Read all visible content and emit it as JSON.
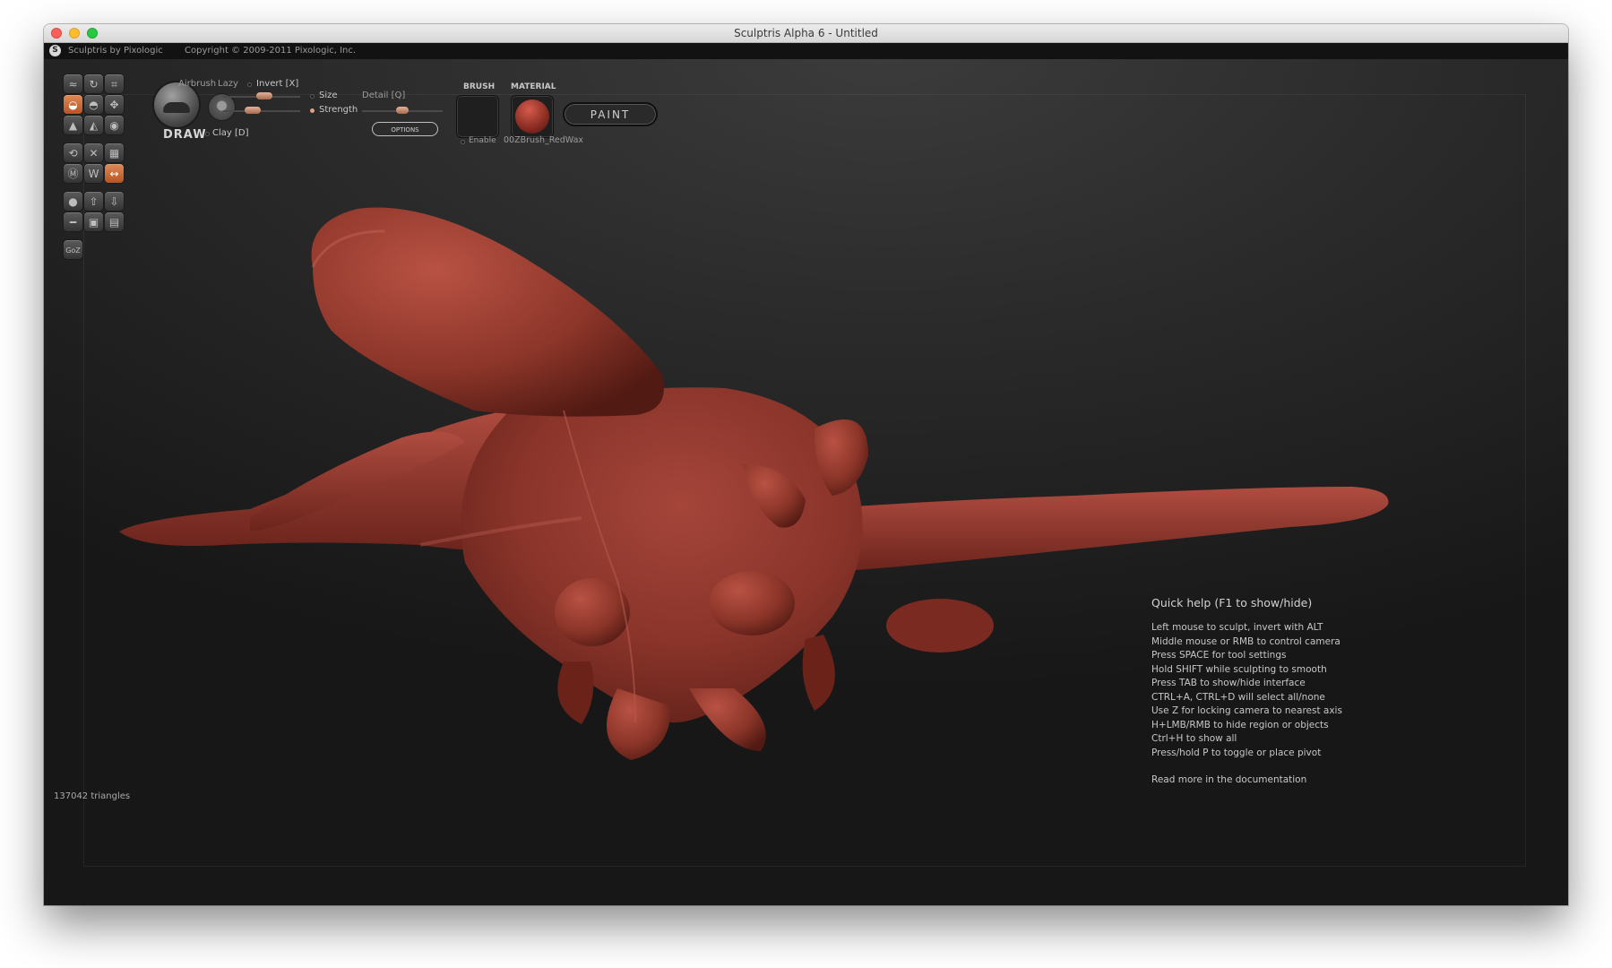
{
  "window": {
    "title": "Sculptris Alpha 6 - Untitled"
  },
  "info_bar": {
    "logo_glyph": "S",
    "app_name": "Sculptris by Pixologic",
    "copyright": "Copyright © 2009-2011 Pixologic, Inc."
  },
  "toolbar": {
    "tool_icons": [
      "brush-stroke-icon",
      "rotate-icon",
      "crop-icon",
      "draw-clay-icon",
      "inflate-icon",
      "move-icon",
      "flatten-icon",
      "pinch-icon",
      "smooth-icon",
      "reduce-icon",
      "mirror-x-icon",
      "grid-icon",
      "wireframe-icon",
      "crease-icon",
      "symmetry-icon",
      "sphere-icon",
      "mesh-import-icon",
      "mesh-export-icon",
      "plane-icon",
      "save-icon",
      "open-icon",
      "goz-icon"
    ],
    "goz_label": "GoZ",
    "active_tool": "draw",
    "brush_name": "DRAW",
    "airbrush_label": "Airbrush",
    "lazy_label": "Lazy",
    "invert_label": "Invert [X]",
    "size_label": "Size",
    "detail_label": "Detail [Q]",
    "strength_label": "Strength",
    "clay_label": "Clay [D]",
    "size_level": 0.55,
    "strength_level": 0.35,
    "detail_level": 0.5,
    "options_label": "OPTIONS",
    "brush_header": "BRUSH",
    "enable_label": "Enable",
    "material_header": "MATERIAL",
    "material_name": "00ZBrush_RedWax",
    "paint_label": "PAINT"
  },
  "quick_help": {
    "title": "Quick help (F1 to show/hide)",
    "lines": [
      "Left mouse to sculpt, invert with ALT",
      "Middle mouse or RMB to control camera",
      "Press SPACE for tool settings",
      "Hold SHIFT while sculpting to smooth",
      "Press TAB to show/hide interface",
      "CTRL+A, CTRL+D will select all/none",
      "Use Z for locking camera to nearest axis",
      "H+LMB/RMB to hide region or objects",
      "Ctrl+H to show all",
      "Press/hold P to toggle or place pivot"
    ],
    "more": "Read more in the documentation"
  },
  "status": {
    "triangles": "137042 triangles"
  },
  "colors": {
    "accent": "#c96a3c",
    "material": "#8f2f25",
    "background": "#2a2a2a"
  }
}
